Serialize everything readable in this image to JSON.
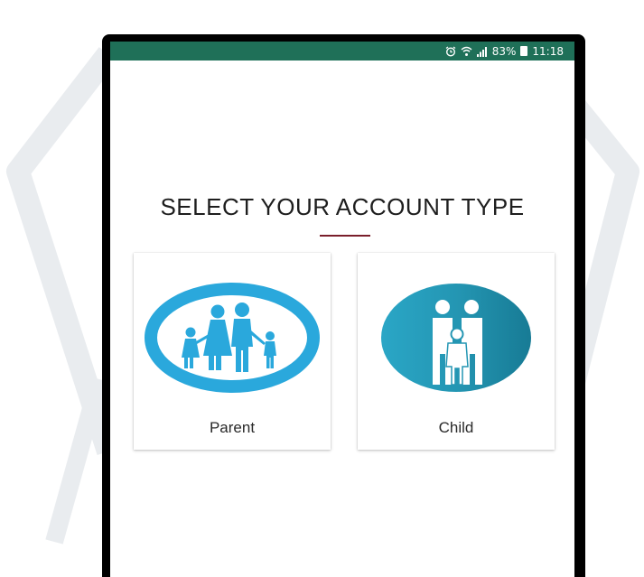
{
  "status_bar": {
    "battery": "83%",
    "time": "11:18",
    "icons": [
      "alarm-icon",
      "wifi-icon",
      "signal-icon",
      "battery-icon"
    ]
  },
  "screen": {
    "title": "SELECT YOUR ACCOUNT TYPE",
    "accent_color": "#7a1e2b"
  },
  "account_types": [
    {
      "label": "Parent",
      "icon": "family-icon",
      "color": "#2aa8dc"
    },
    {
      "label": "Child",
      "icon": "child-icon",
      "color": "#2496b3"
    }
  ],
  "colors": {
    "status_bar": "#1f7058"
  }
}
